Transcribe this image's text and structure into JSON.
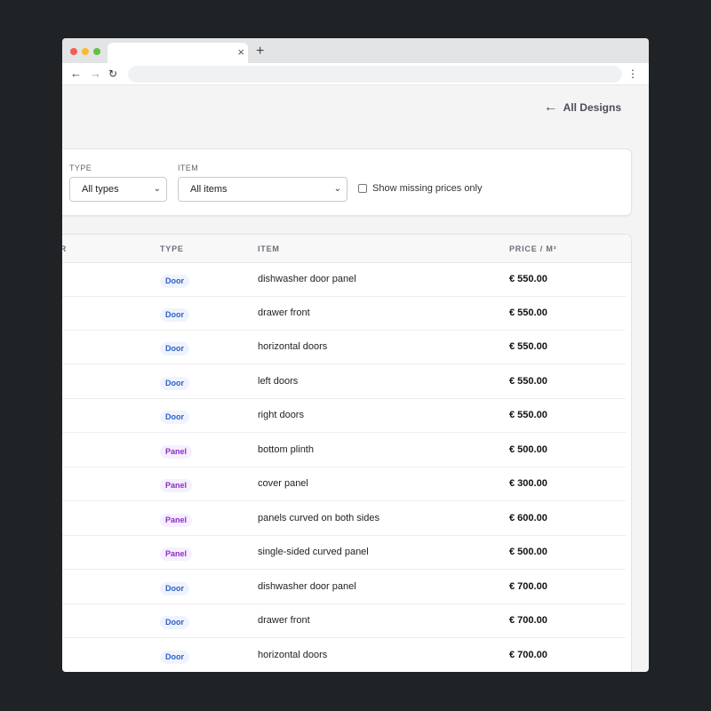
{
  "browser": {
    "tab_close": "×",
    "new_tab": "+",
    "nav_back": "←",
    "nav_forward": "→",
    "nav_reload": "↻",
    "menu": "⋮"
  },
  "header": {
    "back_arrow": "←",
    "back_label": "All Designs"
  },
  "filters": {
    "type_label": "TYPE",
    "type_value": "All types",
    "item_label": "ITEM",
    "item_value": "All items",
    "missing_prices_label": "Show missing prices only",
    "chevron": "⌄"
  },
  "table": {
    "columns": {
      "first_partial": "ER",
      "type": "TYPE",
      "item": "ITEM",
      "price": "PRICE / M²"
    },
    "rows": [
      {
        "type": "Door",
        "kind": "door",
        "item": "dishwasher door panel",
        "price": "€ 550.00"
      },
      {
        "type": "Door",
        "kind": "door",
        "item": "drawer front",
        "price": "€ 550.00"
      },
      {
        "type": "Door",
        "kind": "door",
        "item": "horizontal doors",
        "price": "€ 550.00"
      },
      {
        "type": "Door",
        "kind": "door",
        "item": "left doors",
        "price": "€ 550.00"
      },
      {
        "type": "Door",
        "kind": "door",
        "item": "right doors",
        "price": "€ 550.00"
      },
      {
        "type": "Panel",
        "kind": "panel",
        "item": "bottom plinth",
        "price": "€ 500.00"
      },
      {
        "type": "Panel",
        "kind": "panel",
        "item": "cover panel",
        "price": "€ 300.00"
      },
      {
        "type": "Panel",
        "kind": "panel",
        "item": "panels curved on both sides",
        "price": "€ 600.00"
      },
      {
        "type": "Panel",
        "kind": "panel",
        "item": "single-sided curved panel",
        "price": "€ 500.00"
      },
      {
        "type": "Door",
        "kind": "door",
        "item": "dishwasher door panel",
        "price": "€ 700.00"
      },
      {
        "type": "Door",
        "kind": "door",
        "item": "drawer front",
        "price": "€ 700.00"
      },
      {
        "type": "Door",
        "kind": "door",
        "item": "horizontal doors",
        "price": "€ 700.00"
      }
    ]
  },
  "colors": {
    "door_badge": "#2f5fc4",
    "panel_badge": "#8a2fc2"
  }
}
